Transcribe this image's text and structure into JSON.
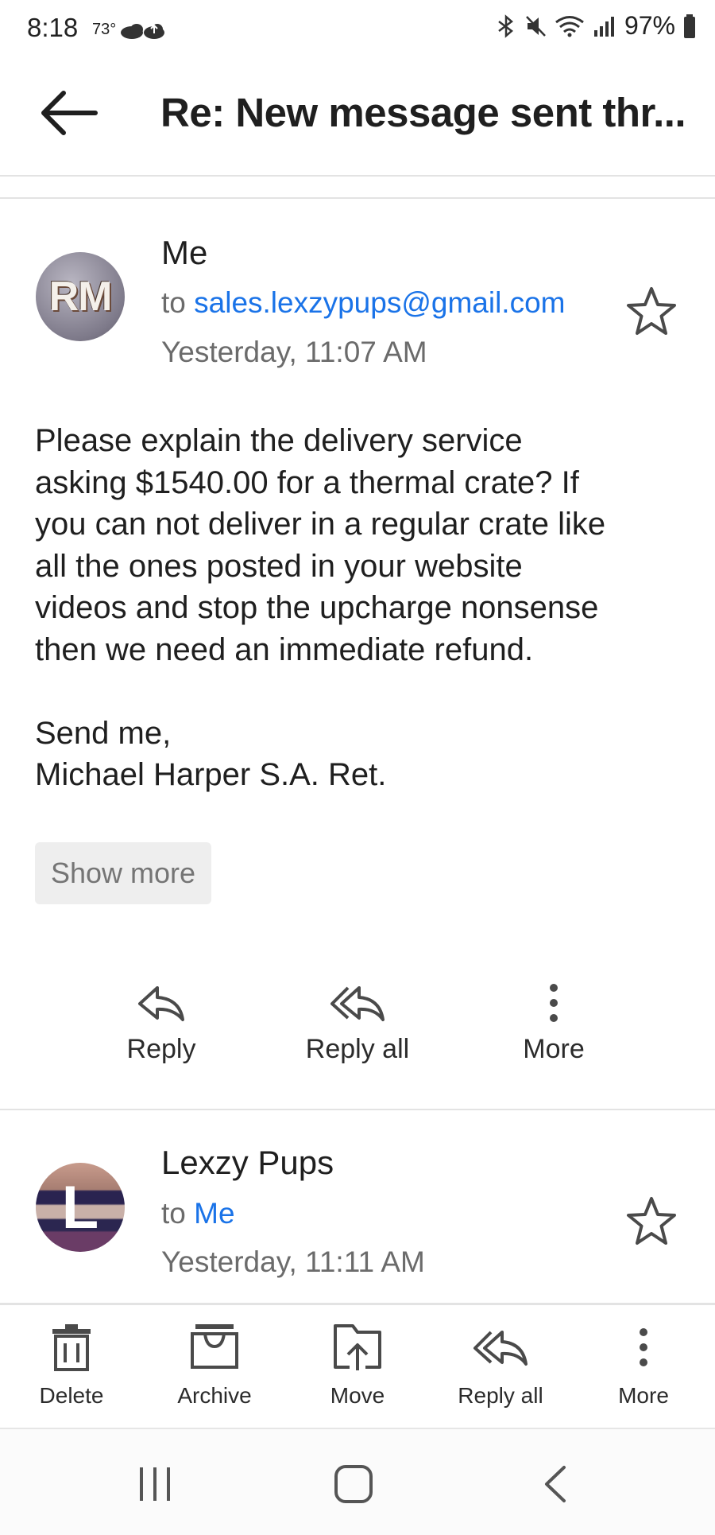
{
  "status_bar": {
    "time": "8:18",
    "temperature": "73°",
    "battery": "97%"
  },
  "header": {
    "title": "Re: New message sent thr..."
  },
  "messages": [
    {
      "avatar_initials": "RM",
      "sender": "Me",
      "to_prefix": "to",
      "to": "sales.lexzypups@gmail.com",
      "timestamp": "Yesterday, 11:07 AM",
      "body": "Please explain the delivery service\nasking $1540.00 for a thermal crate? If\nyou can not deliver in a regular crate like\nall the ones posted in your website\nvideos and stop the upcharge nonsense\nthen we need an immediate refund.\n\nSend me,\nMichael Harper S.A. Ret.",
      "show_more_label": "Show more",
      "actions": [
        "Reply",
        "Reply all",
        "More"
      ]
    },
    {
      "avatar_initials": "L",
      "sender": "Lexzy Pups",
      "to_prefix": "to",
      "to": "Me",
      "timestamp": "Yesterday, 11:11 AM"
    }
  ],
  "toolbar": {
    "items": [
      "Delete",
      "Archive",
      "Move",
      "Reply all",
      "More"
    ]
  },
  "colors": {
    "link": "#1a73e8",
    "secondary_text": "#6b6b6b",
    "icon": "#4a4a4a"
  }
}
